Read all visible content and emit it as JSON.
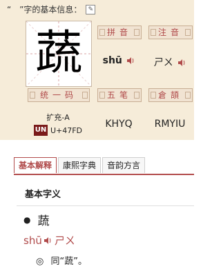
{
  "header": {
    "text": "“　”字的基本信息：",
    "tool_icon": "scroll-icon"
  },
  "character": {
    "glyph": "蔬"
  },
  "labels": {
    "pinyin": "拼音",
    "zhuyin": "注音",
    "unicode": "统一码",
    "wubi": "五笔",
    "cangjie": "倉頡"
  },
  "values": {
    "pinyin": "shū",
    "zhuyin": "ㄕㄨ",
    "unicode_block": "扩充-A",
    "unicode_code": "U+47FD",
    "unicode_logo": "UN",
    "wubi": "KHYQ",
    "cangjie": "RMYIU"
  },
  "tabs": [
    {
      "label": "基本解释",
      "active": true
    },
    {
      "label": "康熙字典",
      "active": false
    },
    {
      "label": "音韵方言",
      "active": false
    }
  ],
  "content": {
    "section_title": "基本字义",
    "bullet": "●",
    "entry_char": "蔬",
    "entry_pinyin": "shū",
    "entry_zhuyin": "ㄕㄨ",
    "def_marker": "◎",
    "definition": "同“蔬”。"
  },
  "colors": {
    "panel_bg": "#f6ecd9",
    "accent": "#b04a4a"
  }
}
